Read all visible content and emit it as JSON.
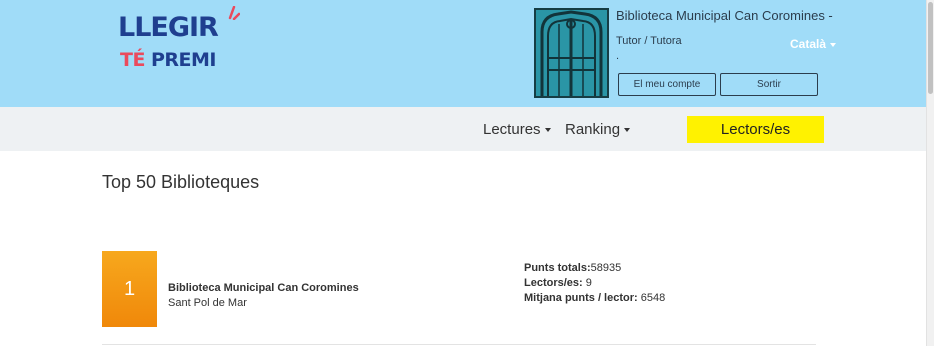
{
  "logo": {
    "line1": "LLEGIR",
    "line2a": "TÉ",
    "line2b": "PREMI"
  },
  "header": {
    "library_name": "Biblioteca Municipal Can Coromines -",
    "role": "Tutor / Tutora",
    "role_extra": ".",
    "language": "Català",
    "account_button": "El meu compte",
    "logout_button": "Sortir",
    "image_icon": "library-facade-image"
  },
  "nav": {
    "lectures": "Lectures",
    "ranking": "Ranking",
    "readers_button": "Lectors/es"
  },
  "page": {
    "title": "Top 50 Biblioteques"
  },
  "ranking": [
    {
      "rank": "1",
      "name": "Biblioteca Municipal Can Coromines",
      "city": "Sant Pol de Mar",
      "total_points_label": "Punts totals:",
      "total_points": "58935",
      "readers_label": "Lectors/es:",
      "readers": " 9",
      "avg_label": "Mitjana punts / lector:",
      "avg": " 6548"
    }
  ],
  "colors": {
    "header_bg": "#a0dcf8",
    "nav_bg": "#eef1f3",
    "cta_bg": "#fff200",
    "badge": "#f39a12",
    "logo_blue": "#1f3f8f",
    "logo_red": "#ea4a5d"
  }
}
